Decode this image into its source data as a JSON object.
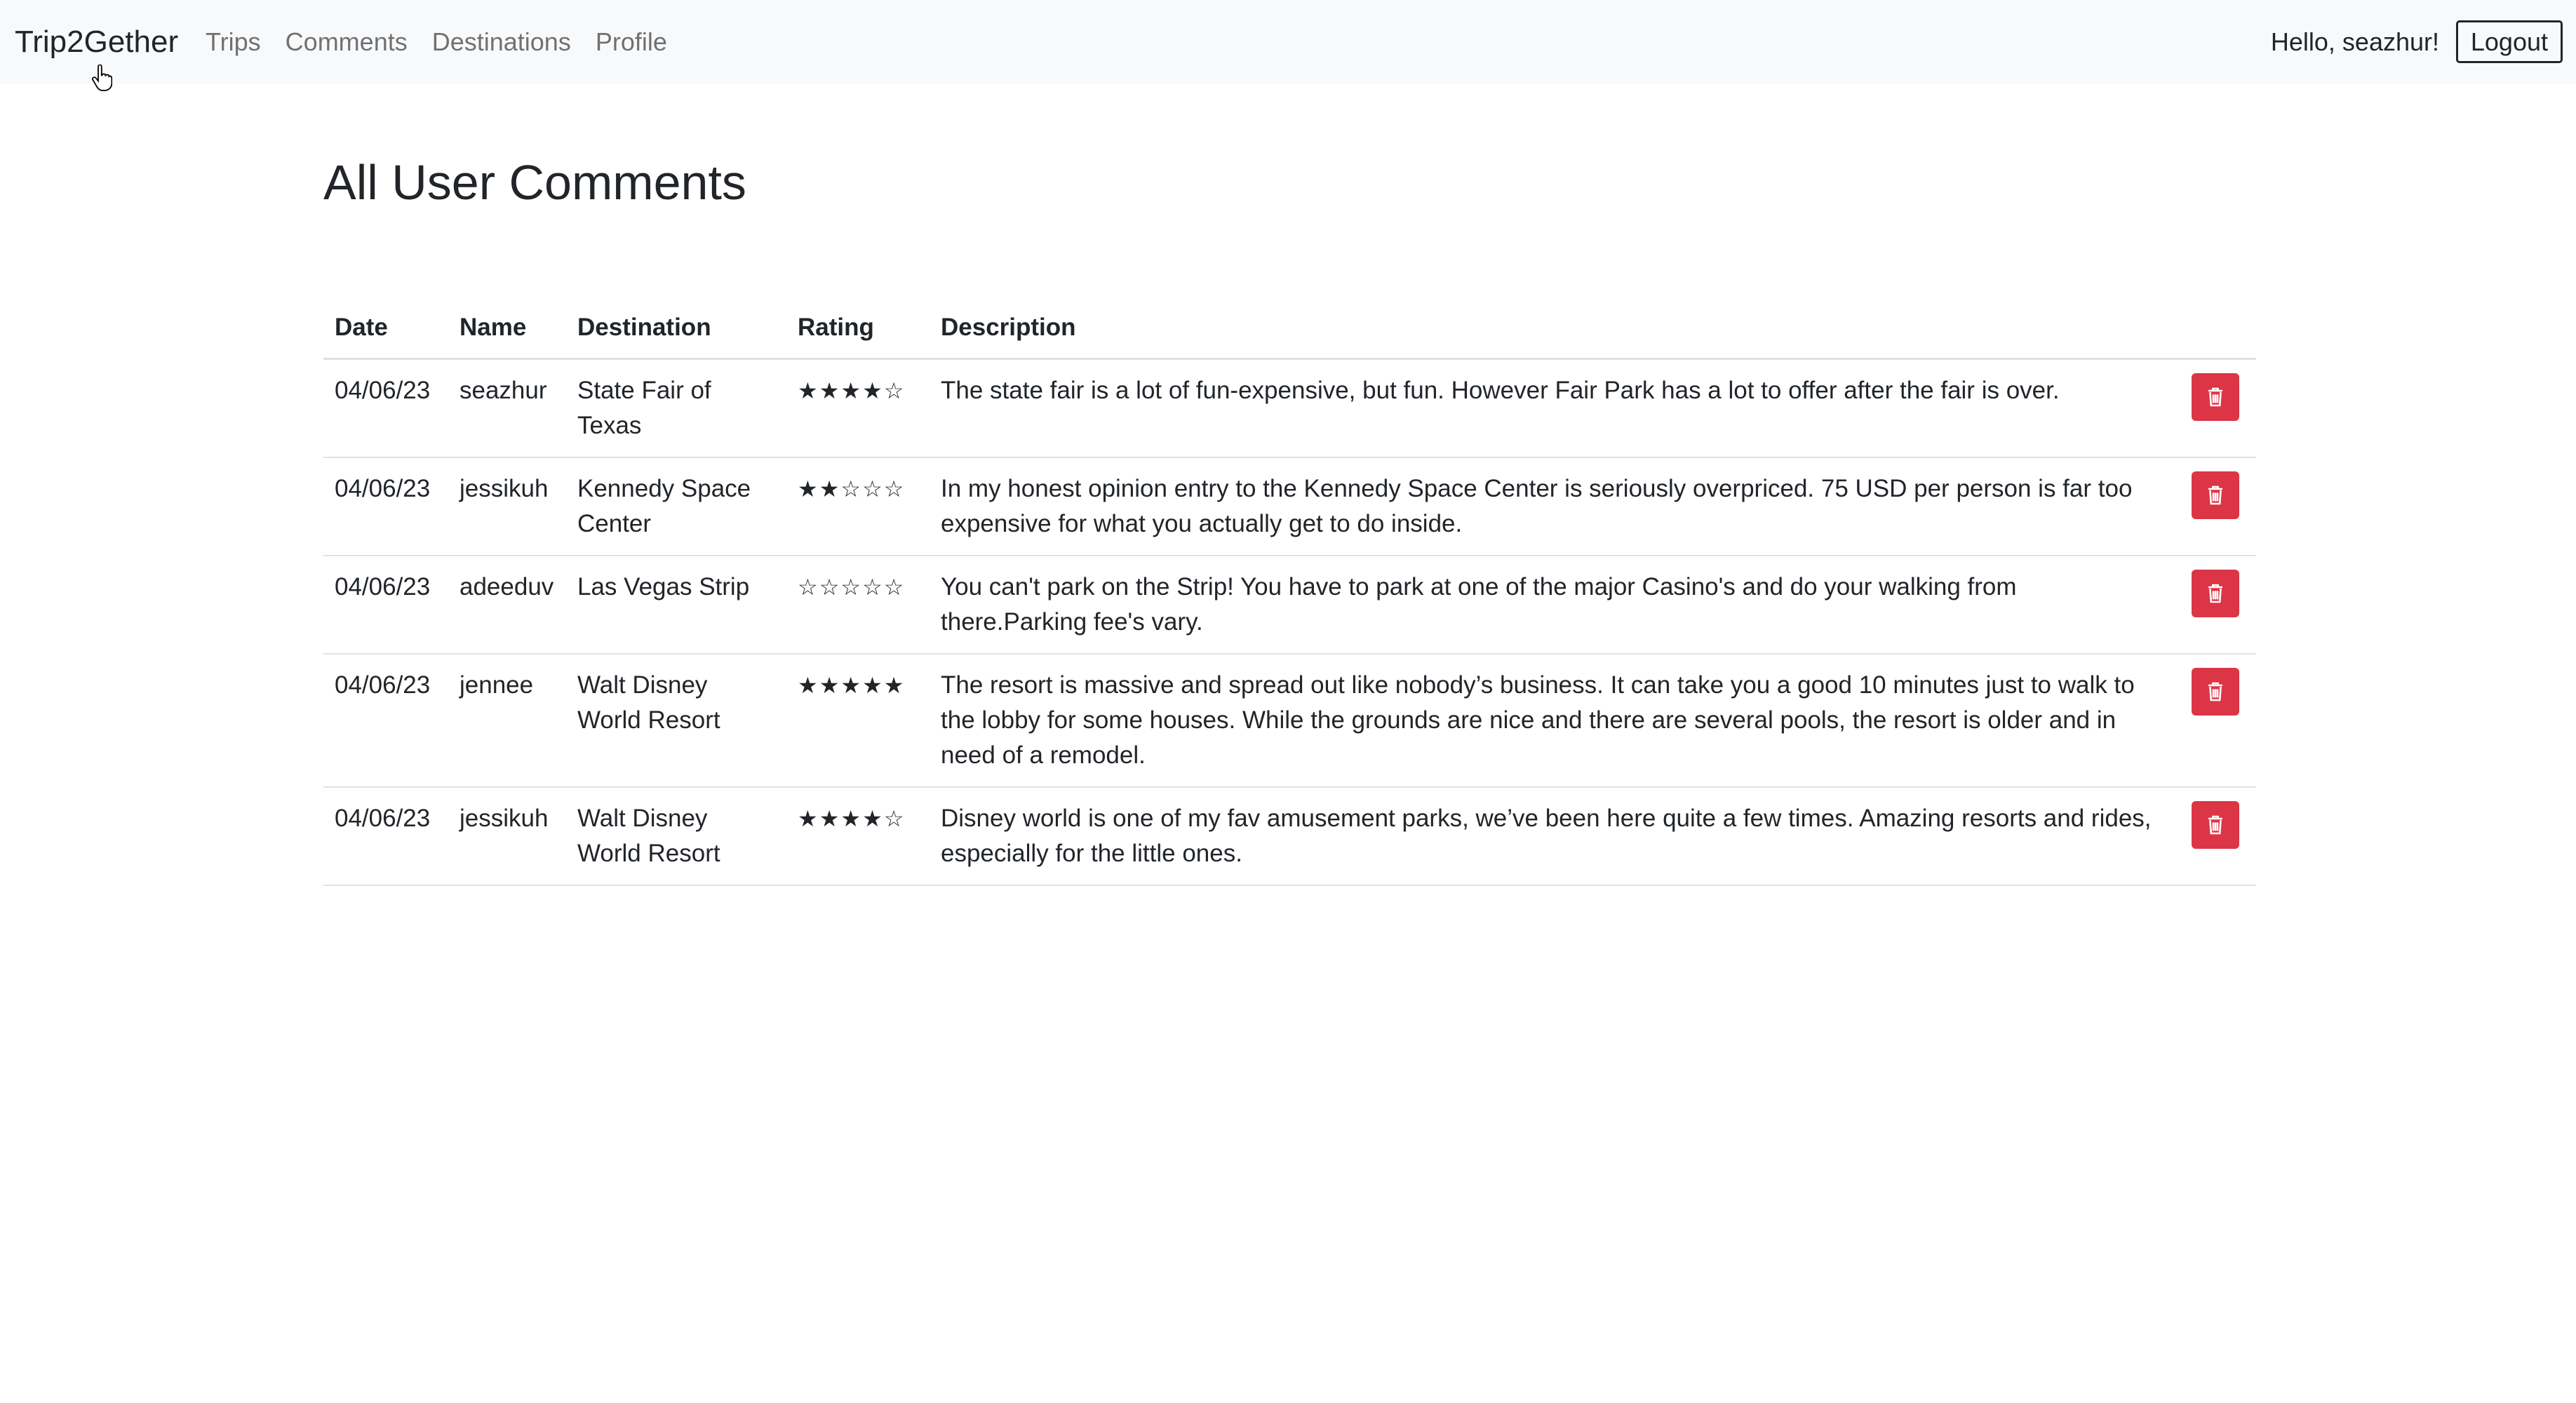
{
  "navbar": {
    "brand": "Trip2Gether",
    "links": [
      "Trips",
      "Comments",
      "Destinations",
      "Profile"
    ],
    "greeting": "Hello, seazhur!",
    "logout_label": "Logout"
  },
  "page": {
    "title": "All User Comments"
  },
  "table": {
    "headers": {
      "date": "Date",
      "name": "Name",
      "destination": "Destination",
      "rating": "Rating",
      "description": "Description"
    },
    "rows": [
      {
        "date": "04/06/23",
        "name": "seazhur",
        "destination": "State Fair of Texas",
        "rating": 4,
        "stars": "★★★★☆",
        "description": "The state fair is a lot of fun-expensive, but fun. However Fair Park has a lot to offer after the fair is over."
      },
      {
        "date": "04/06/23",
        "name": "jessikuh",
        "destination": "Kennedy Space Center",
        "rating": 2,
        "stars": "★★☆☆☆",
        "description": "In my honest opinion entry to the Kennedy Space Center is seriously overpriced. 75 USD per person is far too expensive for what you actually get to do inside."
      },
      {
        "date": "04/06/23",
        "name": "adeeduv",
        "destination": "Las Vegas Strip",
        "rating": 0,
        "stars": "☆☆☆☆☆",
        "description": "You can't park on the Strip! You have to park at one of the major Casino's and do your walking from there.Parking fee's vary."
      },
      {
        "date": "04/06/23",
        "name": "jennee",
        "destination": "Walt Disney World Resort",
        "rating": 5,
        "stars": "★★★★★",
        "description": "The resort is massive and spread out like nobody’s business. It can take you a good 10 minutes just to walk to the lobby for some houses. While the grounds are nice and there are several pools, the resort is older and in need of a remodel."
      },
      {
        "date": "04/06/23",
        "name": "jessikuh",
        "destination": "Walt Disney World Resort",
        "rating": 4,
        "stars": "★★★★☆",
        "description": "Disney world is one of my fav amusement parks, we’ve been here quite a few times. Amazing resorts and rides, especially for the little ones."
      }
    ]
  },
  "icons": {
    "delete": "trash-icon",
    "cursor": "hand-pointer-icon"
  },
  "colors": {
    "navbar_bg": "#f8f9fa",
    "delete_button": "#dc3545",
    "nav_link": "#6c6c6c"
  }
}
